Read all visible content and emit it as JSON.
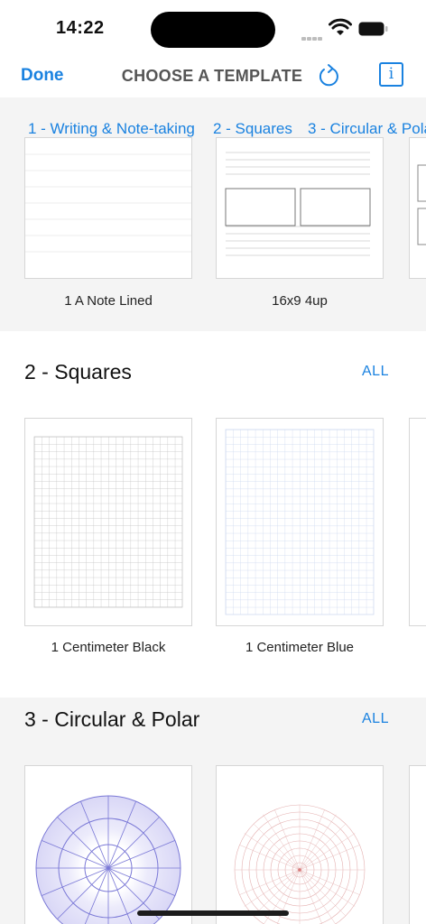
{
  "status": {
    "time": "14:22"
  },
  "nav": {
    "done": "Done",
    "title": "CHOOSE A TEMPLATE",
    "info_glyph": "i"
  },
  "tabs": [
    "1 - Writing & Note-taking",
    "2 - Squares",
    "3 - Circular & Polar"
  ],
  "sections": [
    {
      "cards": [
        {
          "label": "1 A Note Lined"
        },
        {
          "label": "16x9 4up"
        }
      ]
    },
    {
      "title": "2 - Squares",
      "all": "ALL",
      "cards": [
        {
          "label": "1 Centimeter Black"
        },
        {
          "label": "1 Centimeter Blue"
        }
      ]
    },
    {
      "title": "3 - Circular & Polar",
      "all": "ALL",
      "cards": [
        {
          "label": ""
        },
        {
          "label": ""
        }
      ]
    }
  ],
  "colors": {
    "accent": "#1a82e0",
    "grid_black": "#bfbfbf",
    "grid_blue": "#c9d6ee",
    "polar_blue": "#7a78d6",
    "polar_red": "#d87a7a"
  }
}
